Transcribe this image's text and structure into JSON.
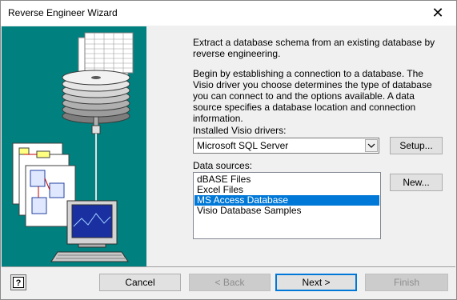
{
  "window": {
    "title": "Reverse Engineer Wizard",
    "close_glyph": "✕"
  },
  "intro": {
    "paragraph1": "Extract a database schema from an existing database by reverse engineering.",
    "paragraph2": "Begin by establishing a connection to a database.  The Visio driver you choose determines the type of database you can connect to and the options available.  A data source specifies a database location and connection information."
  },
  "drivers": {
    "label": "Installed Visio drivers:",
    "selected": "Microsoft SQL Server",
    "setup_label": "Setup..."
  },
  "data_sources": {
    "label": "Data sources:",
    "items": [
      "dBASE Files",
      "Excel Files",
      "MS Access Database",
      "Visio Database Samples"
    ],
    "selected_index": 2,
    "new_label": "New..."
  },
  "footer": {
    "cancel_label": "Cancel",
    "back_label": "< Back",
    "next_label": "Next >",
    "finish_label": "Finish"
  },
  "colors": {
    "art_background": "#00807f",
    "selection": "#0078d7"
  },
  "icons": {
    "close": "close-icon",
    "dropdown": "chevron-down-icon",
    "help": "help-question-icon"
  }
}
